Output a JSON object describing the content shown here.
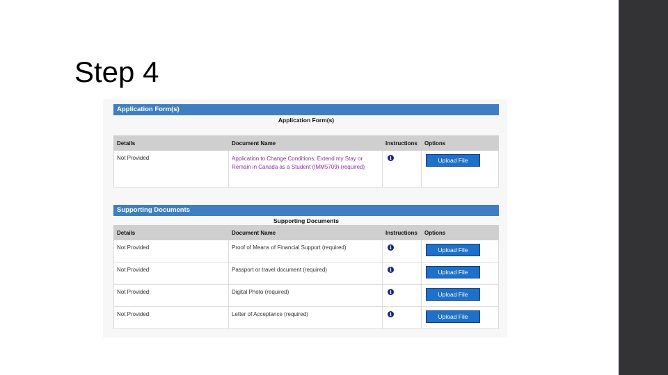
{
  "slide": {
    "title": "Step 4"
  },
  "application_forms": {
    "header": "Application Form(s)",
    "caption": "Application Form(s)",
    "columns": [
      "Details",
      "Document Name",
      "Instructions",
      "Options"
    ],
    "rows": [
      {
        "details": "Not Provided",
        "document_line1": "Application to Change Conditions, Extend my Stay or",
        "document_line2": "Remain in Canada as a Student (IMM5709)  (required)",
        "instructions_icon": "info-icon",
        "option": "Upload File"
      }
    ]
  },
  "supporting_documents": {
    "header": "Supporting Documents",
    "caption": "Supporting Documents",
    "columns": [
      "Details",
      "Document Name",
      "Instructions",
      "Options"
    ],
    "rows": [
      {
        "details": "Not Provided",
        "document": "Proof of Means of Financial Support  (required)",
        "instructions_icon": "info-icon",
        "option": "Upload File"
      },
      {
        "details": "Not Provided",
        "document": "Passport or travel document  (required)",
        "instructions_icon": "info-icon",
        "option": "Upload File"
      },
      {
        "details": "Not Provided",
        "document": "Digital Photo  (required)",
        "instructions_icon": "info-icon",
        "option": "Upload File"
      },
      {
        "details": "Not Provided",
        "document": "Letter of Acceptance  (required)",
        "instructions_icon": "info-icon",
        "option": "Upload File"
      }
    ]
  },
  "colors": {
    "header_blue": "#3f7fc1",
    "button_blue": "#1f70c8",
    "link_purple": "#8a2da0",
    "side_bar": "#333335"
  },
  "info_glyph": "i"
}
